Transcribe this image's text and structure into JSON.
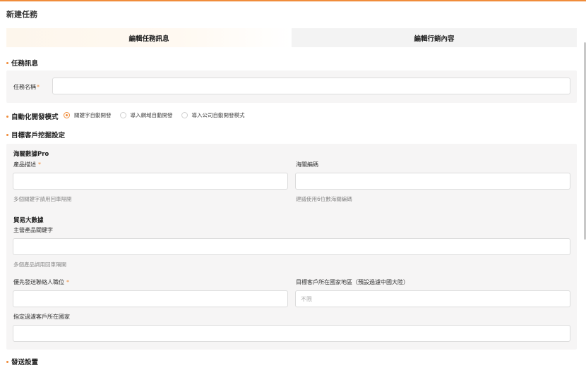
{
  "page_title": "新建任務",
  "tabs": [
    {
      "label": "編輯任務訊息",
      "active": true
    },
    {
      "label": "編輯行銷內容",
      "active": false
    }
  ],
  "accent_color": "#f08c3a",
  "task_info": {
    "section_title": "任務訊息",
    "task_name_label": "任務名稱",
    "task_name_value": ""
  },
  "auto_dev": {
    "section_title": "自動化開發模式",
    "options": [
      {
        "label": "關鍵字自動開發",
        "selected": true
      },
      {
        "label": "導入網域自動開發",
        "selected": false
      },
      {
        "label": "導入公司自動開發模式",
        "selected": false
      }
    ]
  },
  "target": {
    "section_title": "目標客戶挖掘設定",
    "customs_title": "海關數據Pro",
    "product_desc_label": "產品描述",
    "product_desc_hint": "多個關鍵字請用回車隔開",
    "hs_code_label": "海關編碼",
    "hs_code_hint": "建議使用6位數海關編碼",
    "trade_title": "貿易大數據",
    "main_keyword_label": "主營產品關鍵字",
    "main_keyword_hint": "多個產品詞用回車隔開",
    "contact_title_label": "優先發送聯絡人職位",
    "region_label": "目標客戶所在國家地區（預設過濾中國大陸）",
    "region_placeholder": "不限",
    "filter_country_label": "指定過濾客戶所在國家"
  },
  "send": {
    "section_title": "發送設置"
  }
}
